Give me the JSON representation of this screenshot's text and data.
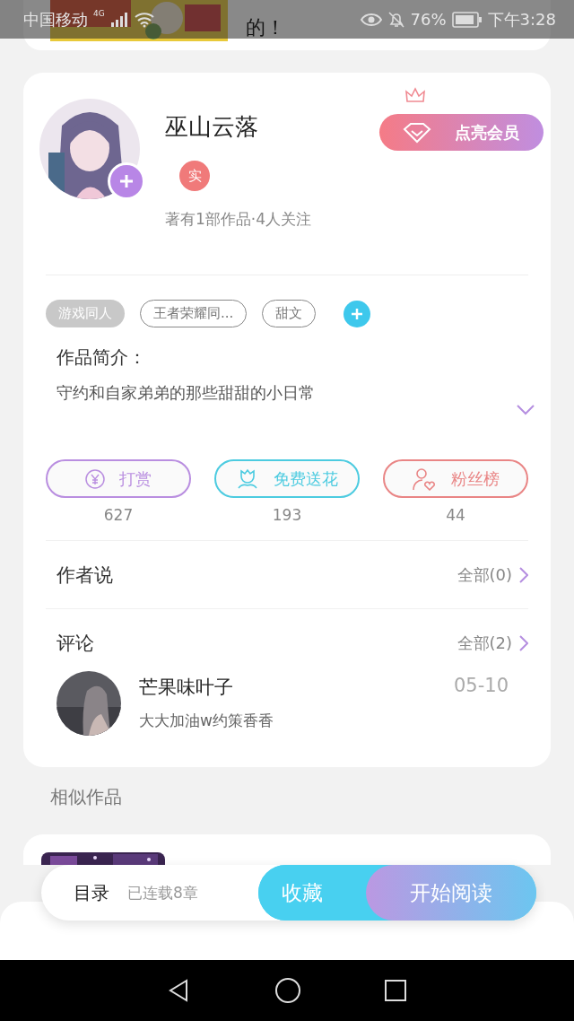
{
  "status_bar": {
    "carrier": "中国移动",
    "network": "4G",
    "battery": "76%",
    "time": "下午3:28"
  },
  "banner": {
    "text": "的！"
  },
  "profile": {
    "name": "巫山云落",
    "badge": "实",
    "stats": "著有1部作品·4人关注",
    "member_button": "点亮会员"
  },
  "tags": [
    {
      "label": "游戏同人",
      "kind": "filled"
    },
    {
      "label": "王者荣耀同...",
      "kind": "outline"
    },
    {
      "label": "甜文",
      "kind": "outline"
    }
  ],
  "intro": {
    "title": "作品简介：",
    "text": "守约和自家弟弟的那些甜甜的小日常"
  },
  "actions": [
    {
      "label": "打赏",
      "count": "627",
      "color": "#b98ee0",
      "kind": "yen"
    },
    {
      "label": "免费送花",
      "count": "193",
      "color": "#4ccbe0",
      "kind": "flower"
    },
    {
      "label": "粉丝榜",
      "count": "44",
      "color": "#e98585",
      "kind": "fans"
    }
  ],
  "sections": [
    {
      "title": "作者说",
      "link": "全部(0)"
    },
    {
      "title": "评论",
      "link": "全部(2)"
    }
  ],
  "comments": [
    {
      "user": "芒果味叶子",
      "date": "05-10",
      "text": "大大加油w约策香香"
    }
  ],
  "similar_title": "相似作品",
  "bottom_bar": {
    "catalog": "目录",
    "progress": "已连载8章",
    "collect": "收藏",
    "read": "开始阅读"
  }
}
